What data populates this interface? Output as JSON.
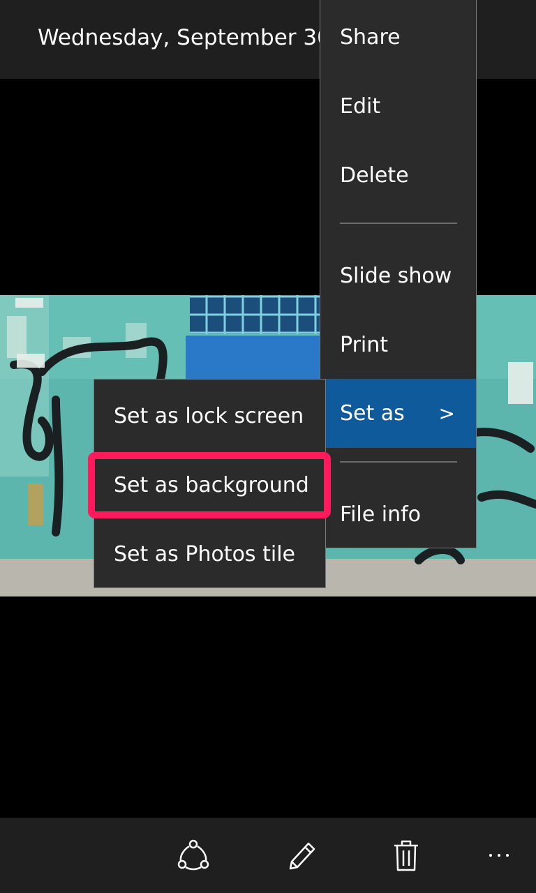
{
  "title_bar": {
    "title": "Wednesday, September 30,"
  },
  "context_menu": {
    "items": [
      {
        "label": "Share"
      },
      {
        "label": "Edit"
      },
      {
        "label": "Delete"
      },
      {
        "label": "Slide show"
      },
      {
        "label": "Print"
      },
      {
        "label": "Set as",
        "has_submenu": true,
        "active": true
      },
      {
        "label": "File info"
      }
    ],
    "chevron": ">"
  },
  "submenu": {
    "items": [
      {
        "label": "Set as lock screen"
      },
      {
        "label": "Set as background",
        "highlighted": true
      },
      {
        "label": "Set as Photos tile"
      }
    ]
  },
  "app_bar": {
    "buttons": [
      {
        "icon": "share-icon"
      },
      {
        "icon": "edit-icon"
      },
      {
        "icon": "delete-icon"
      },
      {
        "icon": "more-icon"
      }
    ]
  },
  "colors": {
    "menu_background": "#2b2b2b",
    "active_item": "#0f5a9a",
    "highlight_border": "#ff1a5b",
    "bar_background": "#1f1f1f"
  }
}
